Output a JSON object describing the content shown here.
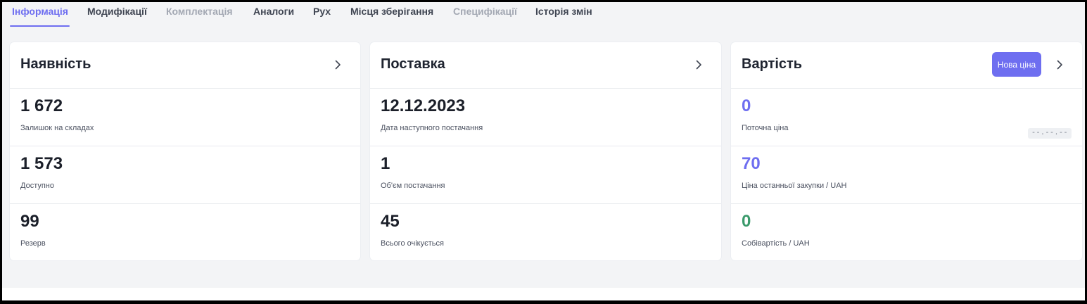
{
  "tabs": [
    {
      "label": "Інформація",
      "state": "active"
    },
    {
      "label": "Модифікації",
      "state": "normal"
    },
    {
      "label": "Комплектація",
      "state": "disabled"
    },
    {
      "label": "Аналоги",
      "state": "normal"
    },
    {
      "label": "Рух",
      "state": "normal"
    },
    {
      "label": "Місця зберігання",
      "state": "normal"
    },
    {
      "label": "Специфікації",
      "state": "disabled"
    },
    {
      "label": "Історія змін",
      "state": "normal"
    }
  ],
  "availability": {
    "title": "Наявність",
    "rows": [
      {
        "value": "1 672",
        "label": "Залишок на складах"
      },
      {
        "value": "1 573",
        "label": "Доступно"
      },
      {
        "value": "99",
        "label": "Резерв"
      }
    ]
  },
  "supply": {
    "title": "Поставка",
    "rows": [
      {
        "value": "12.12.2023",
        "label": "Дата наступного постачання"
      },
      {
        "value": "1",
        "label": "Об'єм постачання"
      },
      {
        "value": "45",
        "label": "Всього очікується"
      }
    ]
  },
  "cost": {
    "title": "Вартість",
    "new_price_label": "Нова ціна",
    "date_badge": "--.--.--",
    "rows": [
      {
        "value": "0",
        "label": "Поточна ціна"
      },
      {
        "value": "70",
        "label": "Ціна останньої закупки / UAH"
      },
      {
        "value": "0",
        "label": "Собівартість / UAH"
      }
    ]
  },
  "colors": {
    "accent": "#6e6ef0",
    "green": "#3a9a6b",
    "disabled_tab": "#a3a8b3"
  },
  "icons": {
    "card_nav": "chevron-right-icon"
  }
}
